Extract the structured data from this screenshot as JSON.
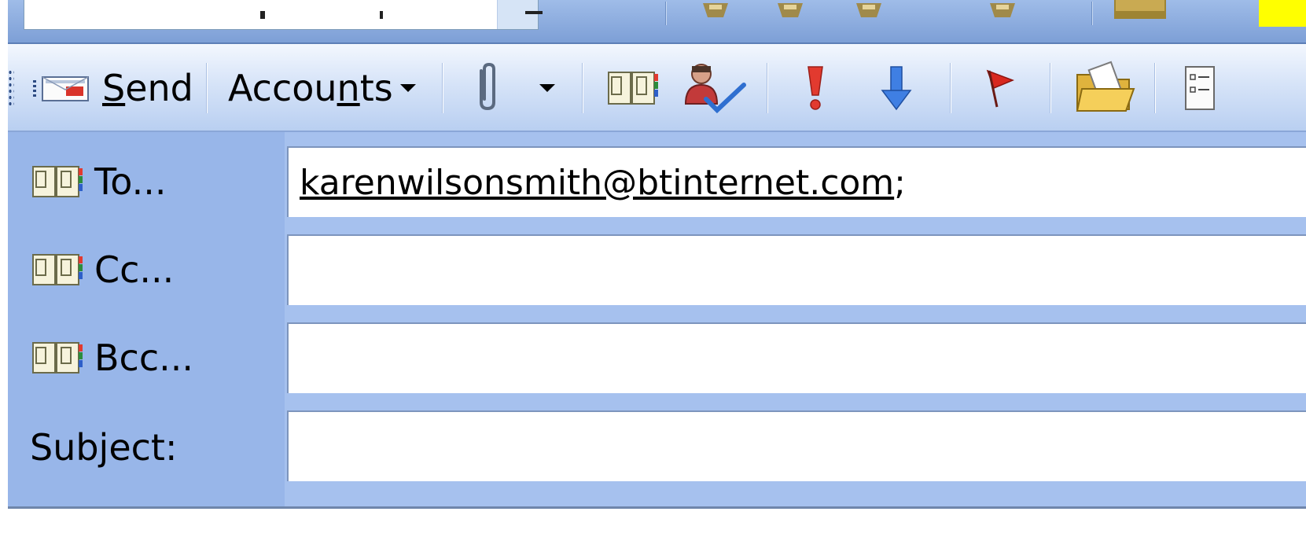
{
  "send_toolbar": {
    "send_label": "Send",
    "send_mnemonic": "S",
    "send_rest": "end",
    "accounts_pre": "Accou",
    "accounts_mnemonic": "n",
    "accounts_post": "ts",
    "icons": [
      "send-envelope-icon",
      "dropdown-arrow-icon",
      "paperclip-icon",
      "attach-dropdown-icon",
      "address-book-icon",
      "check-names-icon",
      "high-importance-icon",
      "low-importance-icon",
      "follow-up-flag-icon",
      "open-folder-icon",
      "options-icon"
    ]
  },
  "header": {
    "to_label": "To...",
    "cc_label": "Cc...",
    "bcc_label": "Bcc...",
    "subject_label": "Subject:",
    "to_value": "karenwilsonsmith@btinternet.com",
    "to_separator": ";",
    "cc_value": "",
    "bcc_value": "",
    "subject_value": ""
  },
  "colors": {
    "toolbar_gradient_top": "#f3f7fe",
    "toolbar_gradient_bottom": "#b9cff1",
    "header_bg": "#a6c1ee",
    "highlight": "#ffff00"
  }
}
